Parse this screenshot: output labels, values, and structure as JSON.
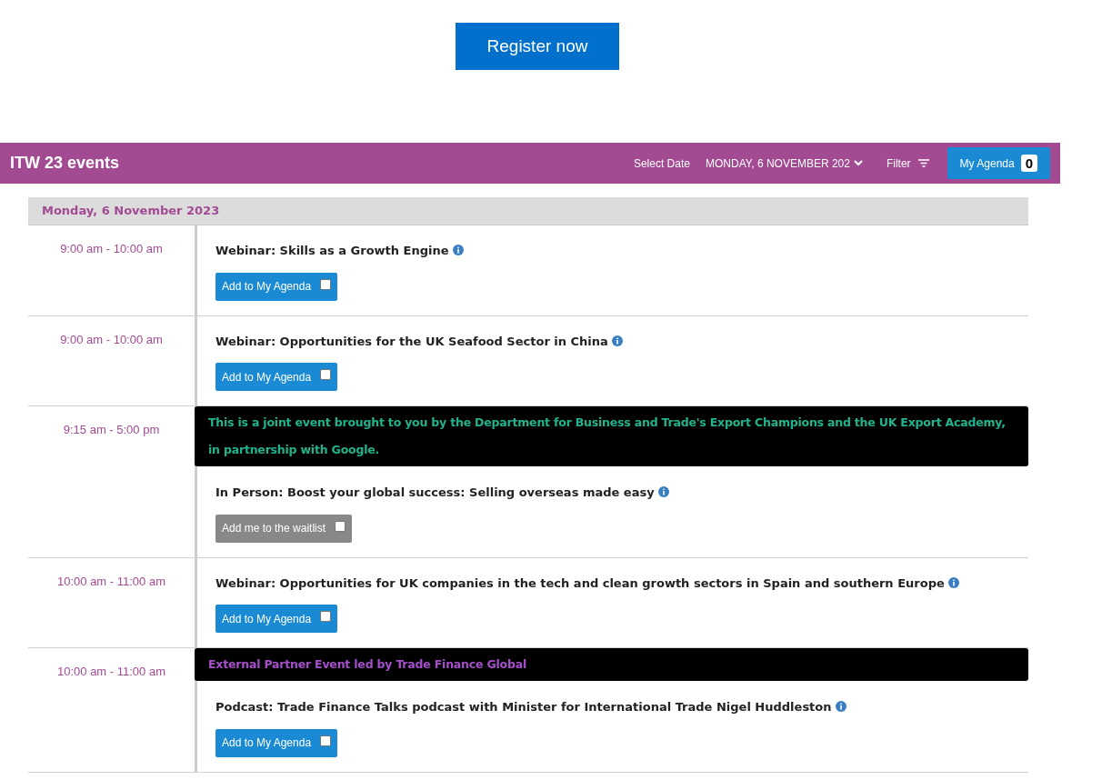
{
  "register_button": "Register now",
  "header": {
    "title": "ITW 23 events",
    "select_date_label": "Select Date",
    "date_value": "MONDAY, 6 NOVEMBER 202",
    "filter_label": "Filter",
    "agenda_button": "My Agenda",
    "agenda_count": "0"
  },
  "day_heading": "Monday, 6 November 2023",
  "events": [
    {
      "time": "9:00 am - 10:00 am",
      "title": "Webinar: Skills as a Growth Engine",
      "action": {
        "kind": "agenda",
        "label": "Add to My Agenda",
        "checked": false
      }
    },
    {
      "time": "9:00 am - 10:00 am",
      "title": "Webinar: Opportunities for the UK Seafood Sector in China",
      "action": {
        "kind": "agenda",
        "label": "Add to My Agenda",
        "checked": false
      }
    },
    {
      "time": "9:15 am - 5:00 pm",
      "banner": {
        "text": "This is a joint event brought to you by the Department for Business and Trade's Export Champions and the UK Export Academy, in partnership with Google.",
        "color": "#21b38d"
      },
      "title": "In Person: Boost your global success: Selling overseas made easy",
      "action": {
        "kind": "waitlist",
        "label": "Add me to the waitlist",
        "checked": false
      }
    },
    {
      "time": "10:00 am - 11:00 am",
      "title": "Webinar: Opportunities for UK companies in the tech and clean growth sectors in Spain and southern Europe",
      "action": {
        "kind": "agenda",
        "label": "Add to My Agenda",
        "checked": false
      }
    },
    {
      "time": "10:00 am - 11:00 am",
      "banner": {
        "text": "External Partner Event led by Trade Finance Global",
        "color": "#a64fcc"
      },
      "title": "Podcast: Trade Finance Talks podcast with Minister for International Trade Nigel Huddleston",
      "action": {
        "kind": "agenda",
        "label": "Add to My Agenda",
        "checked": false
      }
    }
  ]
}
